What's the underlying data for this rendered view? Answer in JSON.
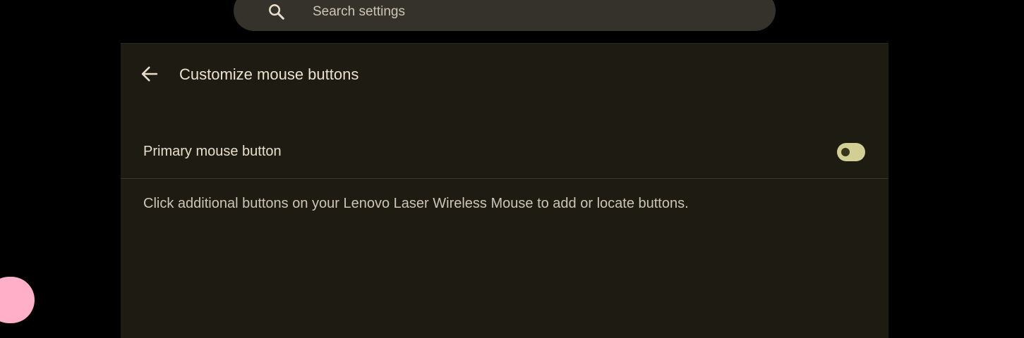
{
  "search": {
    "placeholder": "Search settings",
    "icon": "search-icon"
  },
  "header": {
    "back_icon": "arrow-left-icon",
    "title": "Customize mouse buttons"
  },
  "settings": {
    "primary_button": {
      "label": "Primary mouse button",
      "toggle_on": false
    },
    "hint": "Click additional buttons on your Lenovo Laser Wireless Mouse to add or locate buttons."
  },
  "colors": {
    "background": "#000000",
    "panel": "#1e1b12",
    "search_bar": "#35322b",
    "accent": "#d2cf94",
    "text_primary": "#eae2cf",
    "text_secondary": "#cdc6b4",
    "floating_bubble": "#ffb0c8"
  }
}
